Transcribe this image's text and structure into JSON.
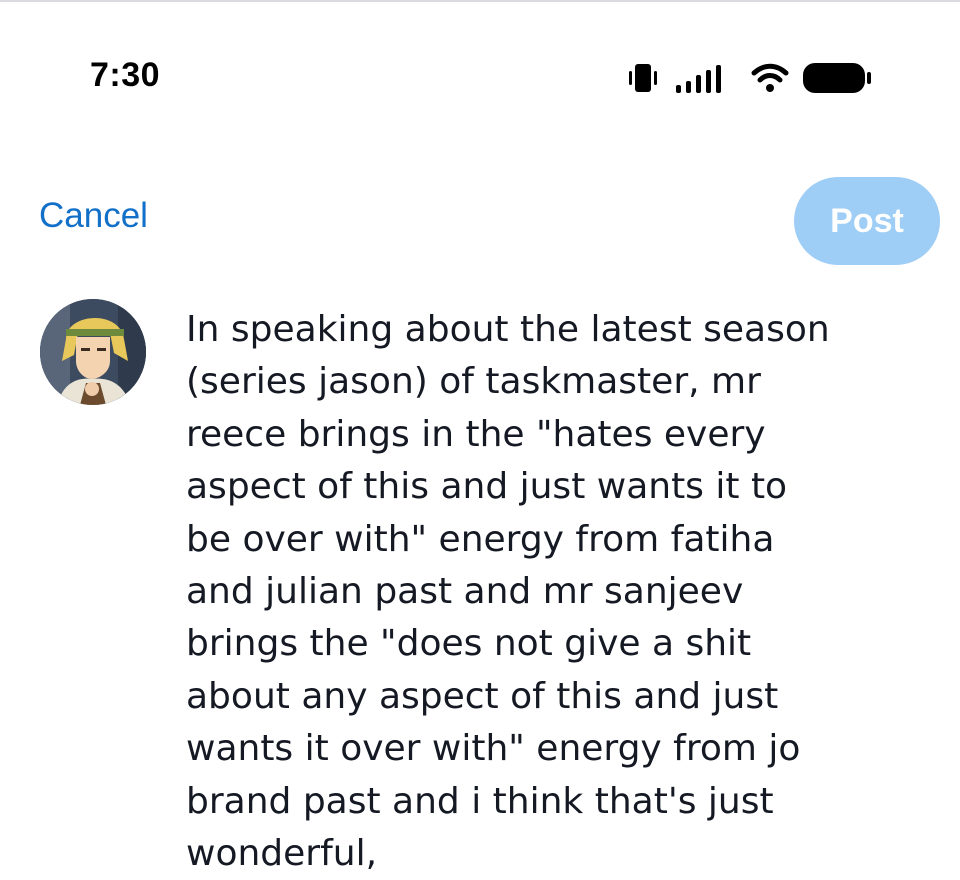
{
  "status_bar": {
    "time": "7:30",
    "icons": [
      "vibrate-icon",
      "signal-icon",
      "wifi-icon",
      "battery-icon"
    ]
  },
  "header": {
    "cancel_label": "Cancel",
    "post_label": "Post"
  },
  "colors": {
    "accent": "#1270c9",
    "post_button_disabled": "#9ecdf6",
    "text": "#151923",
    "background": "#ffffff"
  },
  "composer": {
    "avatar_icon": "user-avatar",
    "lines": [
      "In speaking about the latest season",
      "(series jason) of taskmaster, mr",
      "reece brings in the \"hates every",
      "aspect of this and just wants it to",
      "be over with\" energy from fatiha",
      "and julian past and mr sanjeev",
      "brings the \"does not give a shit",
      "about any aspect of this and just",
      "wants it over with\" energy from jo",
      "brand past and i think that's just",
      "wonderful,"
    ]
  }
}
